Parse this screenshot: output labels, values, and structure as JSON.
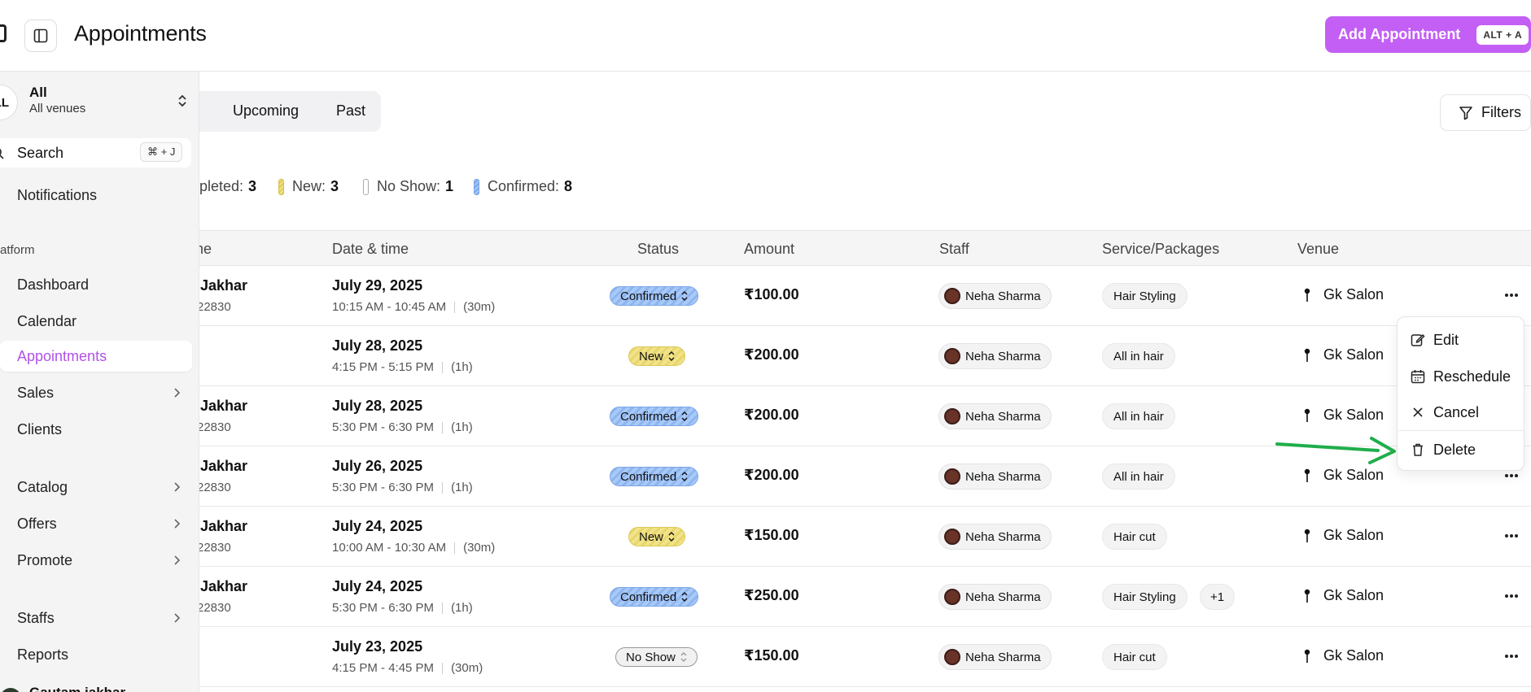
{
  "header": {
    "title": "Appointments",
    "add_button": "Add Appointment",
    "add_shortcut": "ALT + A"
  },
  "sidebar": {
    "venue_avatar": "LL",
    "venue_name": "All",
    "venue_sub": "All venues",
    "search_label": "Search",
    "search_shortcut": "⌘ + J",
    "notifications": "Notifications",
    "section_label": "atform",
    "items": [
      {
        "label": "Dashboard"
      },
      {
        "label": "Calendar"
      },
      {
        "label": "Appointments"
      },
      {
        "label": "Sales"
      },
      {
        "label": "Clients"
      },
      {
        "label": "Catalog"
      },
      {
        "label": "Offers"
      },
      {
        "label": "Promote"
      },
      {
        "label": "Staffs"
      },
      {
        "label": "Reports"
      }
    ],
    "user_name": "Gautam jakhar"
  },
  "tabs": {
    "upcoming": "Upcoming",
    "past": "Past"
  },
  "filters_label": "Filters",
  "legend": [
    {
      "label": "pleted:",
      "count": "3",
      "color": "#000000"
    },
    {
      "label": "New:",
      "count": "3",
      "color": "#e8d66b"
    },
    {
      "label": "No Show:",
      "count": "1",
      "color": "#ffffff"
    },
    {
      "label": "Confirmed:",
      "count": "8",
      "color": "#8cb5f0"
    }
  ],
  "table": {
    "headers": {
      "name": "ne",
      "datetime": "Date & time",
      "status": "Status",
      "amount": "Amount",
      "staff": "Staff",
      "service": "Service/Packages",
      "venue": "Venue"
    },
    "rows": [
      {
        "name": "Jakhar",
        "phone": "22830",
        "date": "July 29, 2025",
        "time": "10:15 AM - 10:45 AM",
        "duration": "(30m)",
        "status": "Confirmed",
        "status_type": "confirmed",
        "amount": "₹100.00",
        "staff": "Neha Sharma",
        "service": "Hair Styling",
        "extra": "",
        "venue": "Gk Salon"
      },
      {
        "name": "",
        "phone": "",
        "date": "July 28, 2025",
        "time": "4:15 PM - 5:15 PM",
        "duration": "(1h)",
        "status": "New",
        "status_type": "new",
        "amount": "₹200.00",
        "staff": "Neha Sharma",
        "service": "All in hair",
        "extra": "",
        "venue": "Gk Salon"
      },
      {
        "name": "Jakhar",
        "phone": "22830",
        "date": "July 28, 2025",
        "time": "5:30 PM - 6:30 PM",
        "duration": "(1h)",
        "status": "Confirmed",
        "status_type": "confirmed",
        "amount": "₹200.00",
        "staff": "Neha Sharma",
        "service": "All in hair",
        "extra": "",
        "venue": "Gk Salon"
      },
      {
        "name": "Jakhar",
        "phone": "22830",
        "date": "July 26, 2025",
        "time": "5:30 PM - 6:30 PM",
        "duration": "(1h)",
        "status": "Confirmed",
        "status_type": "confirmed",
        "amount": "₹200.00",
        "staff": "Neha Sharma",
        "service": "All in hair",
        "extra": "",
        "venue": "Gk Salon"
      },
      {
        "name": "Jakhar",
        "phone": "22830",
        "date": "July 24, 2025",
        "time": "10:00 AM - 10:30 AM",
        "duration": "(30m)",
        "status": "New",
        "status_type": "new",
        "amount": "₹150.00",
        "staff": "Neha Sharma",
        "service": "Hair cut",
        "extra": "",
        "venue": "Gk Salon"
      },
      {
        "name": "Jakhar",
        "phone": "22830",
        "date": "July 24, 2025",
        "time": "5:30 PM - 6:30 PM",
        "duration": "(1h)",
        "status": "Confirmed",
        "status_type": "confirmed",
        "amount": "₹250.00",
        "staff": "Neha Sharma",
        "service": "Hair Styling",
        "extra": "+1",
        "venue": "Gk Salon"
      },
      {
        "name": "",
        "phone": "",
        "date": "July 23, 2025",
        "time": "4:15 PM - 4:45 PM",
        "duration": "(30m)",
        "status": "No Show",
        "status_type": "noshow",
        "amount": "₹150.00",
        "staff": "Neha Sharma",
        "service": "Hair cut",
        "extra": "",
        "venue": "Gk Salon"
      }
    ]
  },
  "row_menu": {
    "edit": "Edit",
    "reschedule": "Reschedule",
    "cancel": "Cancel",
    "delete": "Delete"
  },
  "colors": {
    "accent": "#c45ff5",
    "active_nav": "#b052e8",
    "confirmed": "#8cb5f0",
    "new": "#e8d66b",
    "arrow": "#1fae4b"
  }
}
